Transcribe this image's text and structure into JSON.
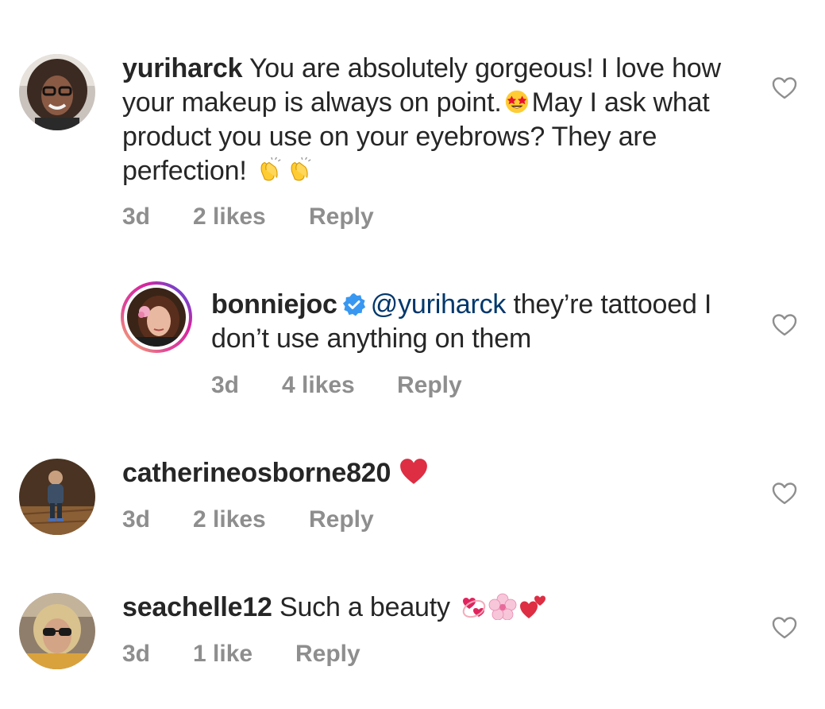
{
  "comments": [
    {
      "username": "yuriharck",
      "text_part1": "You are absolutely gorgeous! I love how your makeup is always on point.",
      "emoji1": "star-struck-emoji",
      "text_part2": "May I ask what product you use on your eyebrows? They are perfection!",
      "emoji2": "clapping-hands-emoji",
      "time": "3d",
      "likes": "2 likes",
      "reply": "Reply"
    },
    {
      "username": "bonniejoc",
      "verified": true,
      "mention": "@yuriharck",
      "text": "they’re tattooed I don’t use anything on them",
      "time": "3d",
      "likes": "4 likes",
      "reply": "Reply"
    },
    {
      "username": "catherineosborne820",
      "emoji": "red-heart-emoji",
      "time": "3d",
      "likes": "2 likes",
      "reply": "Reply"
    },
    {
      "username": "seachelle12",
      "text": "Such a beauty",
      "emoji": [
        "revolving-hearts-emoji",
        "cherry-blossom-emoji",
        "two-hearts-emoji"
      ],
      "time": "3d",
      "likes": "1 like",
      "reply": "Reply"
    }
  ],
  "colors": {
    "text": "#262626",
    "meta": "#8e8e8e",
    "mention": "#00376b",
    "verified": "#3897f0",
    "story_ring": "#d6249f"
  }
}
